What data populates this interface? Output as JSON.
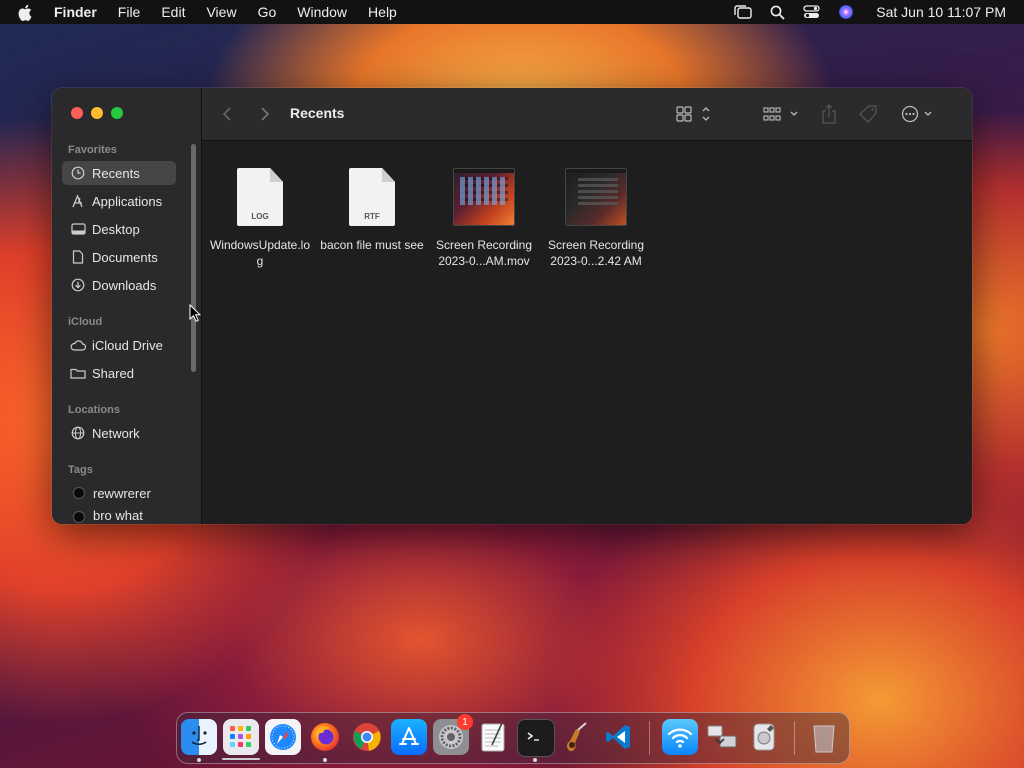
{
  "menubar": {
    "items": [
      "Finder",
      "File",
      "Edit",
      "View",
      "Go",
      "Window",
      "Help"
    ],
    "clock": "Sat Jun 10  11:07 PM"
  },
  "window": {
    "title": "Recents",
    "sidebar": {
      "favorites_title": "Favorites",
      "favorites": [
        "Recents",
        "Applications",
        "Desktop",
        "Documents",
        "Downloads"
      ],
      "icloud_title": "iCloud",
      "icloud": [
        "iCloud Drive",
        "Shared"
      ],
      "locations_title": "Locations",
      "locations": [
        "Network"
      ],
      "tags_title": "Tags",
      "tags": [
        "rewwrerer",
        "bro what"
      ]
    },
    "files": [
      {
        "name": "WindowsUpdate.log",
        "ext": "LOG",
        "kind": "document"
      },
      {
        "name": "bacon file must see",
        "ext": "RTF",
        "kind": "document"
      },
      {
        "name": "Screen Recording 2023-0...AM.mov",
        "kind": "video"
      },
      {
        "name": "Screen Recording 2023-0...2.42 AM",
        "kind": "video"
      }
    ]
  },
  "dock": {
    "apps": [
      "Finder",
      "Launchpad",
      "Safari",
      "Firefox",
      "Chrome",
      "App Store",
      "System Settings",
      "TextEdit",
      "Terminal",
      "Instruments",
      "Visual Studio Code",
      "Wireless Diagnostics",
      "Migration Assistant",
      "Disk Utility",
      "Trash"
    ],
    "settings_badge": "1"
  },
  "colors": {
    "close": "#ff5f57",
    "minimize": "#febc2e",
    "zoom": "#28c840",
    "accent": "#0a84ff"
  }
}
